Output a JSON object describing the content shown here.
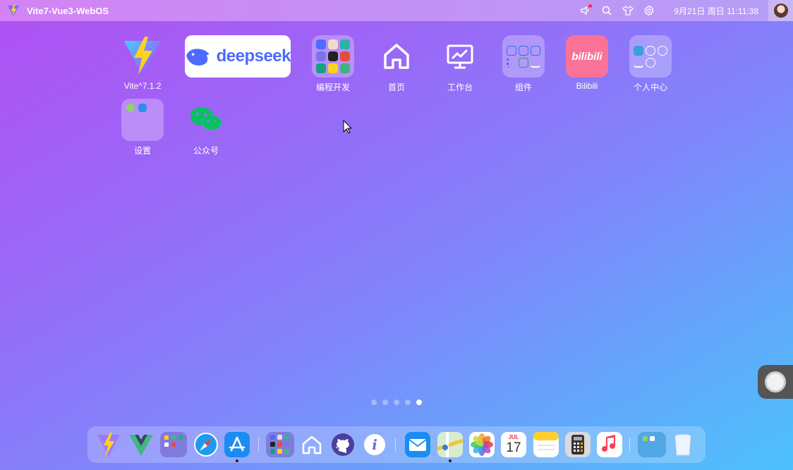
{
  "topbar": {
    "title": "Vite7-Vue3-WebOS",
    "clock": "9月21日 周日 11:11:38",
    "icons": [
      "speaker-icon",
      "search-icon",
      "shirt-icon",
      "gear-icon"
    ]
  },
  "desktop": {
    "apps": [
      {
        "id": "vite",
        "label": "Vite^7.1.2"
      },
      {
        "id": "deepseek",
        "label": "deepseek"
      },
      {
        "id": "dev",
        "label": "编程开发"
      },
      {
        "id": "home",
        "label": "首页"
      },
      {
        "id": "workbench",
        "label": "工作台"
      },
      {
        "id": "widgets",
        "label": "组件"
      },
      {
        "id": "bilibili",
        "label": "Bilibili"
      },
      {
        "id": "profile",
        "label": "个人中心"
      },
      {
        "id": "settings",
        "label": "设置"
      },
      {
        "id": "wechat",
        "label": "公众号"
      }
    ],
    "bilibili_logo": "bilibili"
  },
  "pager": {
    "count": 5,
    "active": 5
  },
  "dock": {
    "items": [
      "vite",
      "vue",
      "folder",
      "safari",
      "appstore",
      "dev-folder",
      "home",
      "github",
      "info",
      "mail",
      "maps",
      "photos",
      "calendar",
      "notes",
      "calculator",
      "music",
      "settings-folder",
      "trash"
    ],
    "calendar_month": "JUL",
    "calendar_day": "17",
    "info_glyph": "i"
  },
  "colors": {
    "bg_start": "#b14ff3",
    "bg_end": "#4cc1fb",
    "deepseek": "#4d6bfe",
    "bilibili": "#fb7299",
    "wechat": "#07c160"
  }
}
